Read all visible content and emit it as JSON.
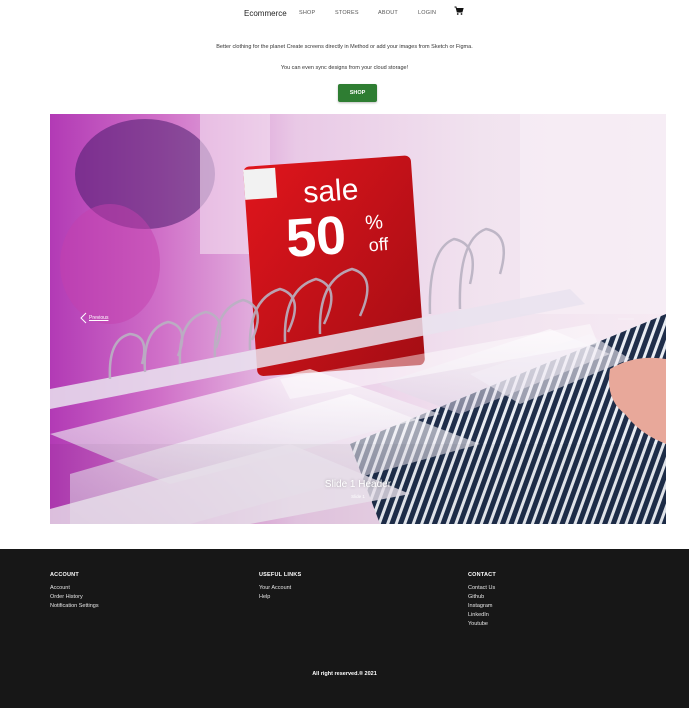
{
  "nav": {
    "brand": "Ecommerce",
    "links": [
      "SHOP",
      "STORES",
      "ABOUT",
      "LOGIN"
    ],
    "cart_icon": "shopping-cart-icon"
  },
  "hero": {
    "line1": "Better clothing for the planet Create screens directly in Method or add your images from Sketch or Figma.",
    "line2": "You can even sync designs from your cloud storage!",
    "button_label": "SHOP",
    "button_color": "#2e7d32"
  },
  "carousel": {
    "prev_label": "Previous",
    "prev_icon": "chevron-left-icon",
    "next_icon": "chevron-right-icon",
    "slide_title": "Slide 1 Header",
    "slide_subtitle": "Slide 1",
    "sign_text": {
      "word": "sale",
      "number": "50",
      "percent": "%",
      "suffix": "off"
    }
  },
  "footer": {
    "background": "#171717",
    "columns": [
      {
        "heading": "ACCOUNT",
        "links": [
          "Account",
          "Order History",
          "Notification Settings"
        ]
      },
      {
        "heading": "USEFUL LINKS",
        "links": [
          "Your Account",
          "Help"
        ]
      },
      {
        "heading": "CONTACT",
        "links": [
          "Contact Us",
          "Github",
          "Instagram",
          "LinkedIn",
          "Youtube"
        ]
      }
    ],
    "copyright": "All right reserved.® 2021"
  }
}
